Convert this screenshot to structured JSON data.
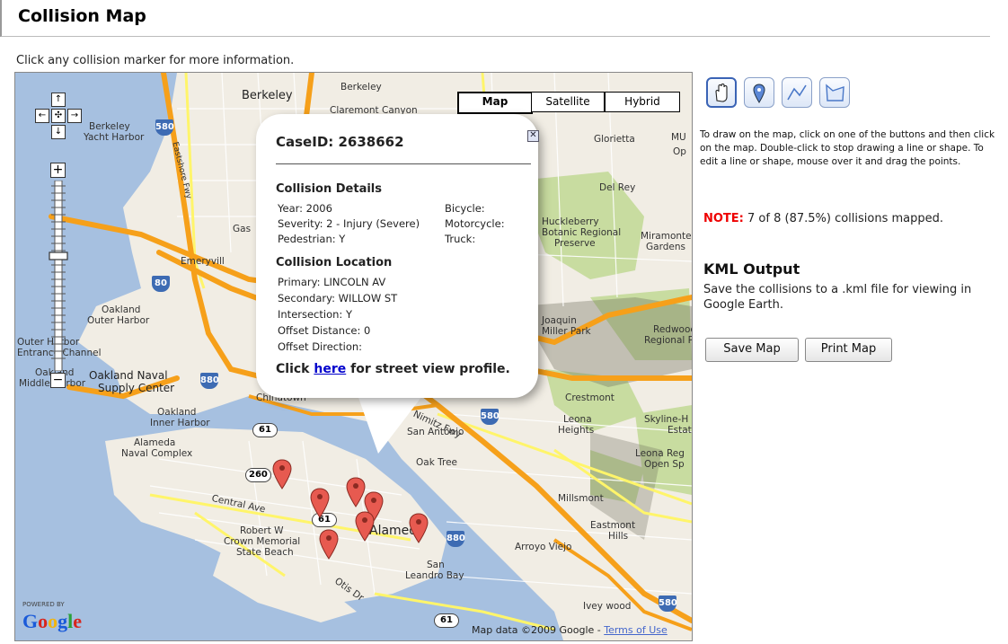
{
  "page": {
    "title": "Collision Map",
    "subtitle": "Click any collision marker for more information."
  },
  "map": {
    "type_buttons": [
      "Map",
      "Satellite",
      "Hybrid"
    ],
    "active_type": "Map",
    "pan_icons": [
      "arrow-up-icon",
      "arrow-left-icon",
      "pan-center-icon",
      "arrow-right-icon",
      "arrow-down-icon"
    ],
    "zoom_in": "+",
    "zoom_out": "−",
    "place_labels": [
      "Berkeley",
      "Berkeley",
      "Claremont Canyon",
      "Berkeley",
      "Yacht Harbor",
      "Eastshore Fwy",
      "Gas",
      "Emeryvill",
      "Oakland",
      "Outer Harbor",
      "Outer Harbor",
      "Entrance Channel",
      "Oakland",
      "Middle Harbor",
      "Oakland Naval",
      "Supply Center",
      "Chinatown",
      "Oakland",
      "Inner Harbor",
      "Alameda",
      "Naval Complex",
      "Central Ave",
      "Robert W",
      "Crown Memorial",
      "State Beach",
      "Alameda",
      "San",
      "Leandro Bay",
      "Otis Dr",
      "Glorietta",
      "Del Rey",
      "Huckleberry",
      "Botanic Regional",
      "Preserve",
      "Miramonte",
      "Gardens",
      "Joaquin",
      "Miller Park",
      "Redwood",
      "Regional Park",
      "Crestmont",
      "Leona",
      "Heights",
      "Skyline-H",
      "Estat",
      "Leona Reg",
      "Open Sp",
      "Oak Tree",
      "San Antonio",
      "Millsmont",
      "Eastmont",
      "Hills",
      "Arroyo Viejo",
      "Ivey wood",
      "Nimitz Fwy"
    ],
    "highway_shields": [
      "580",
      "80",
      "880",
      "61",
      "260",
      "61",
      "61",
      "880",
      "580",
      "580",
      "MU",
      "Op"
    ],
    "popup": {
      "case_id": "CaseID: 2638662",
      "close_icon": "close-x-icon",
      "details_heading": "Collision Details",
      "details_left": [
        "Year: 2006",
        "Severity: 2 - Injury (Severe)",
        "Pedestrian: Y"
      ],
      "details_right": [
        "Bicycle:",
        "Motorcycle:",
        "Truck:"
      ],
      "location_heading": "Collision Location",
      "location": [
        "Primary: LINCOLN AV",
        "Secondary: WILLOW ST",
        "Intersection: Y",
        "Offset Distance: 0",
        "Offset Direction:"
      ],
      "streetview_prefix": "Click ",
      "streetview_link": "here",
      "streetview_suffix": " for street view profile."
    },
    "marker_count": 8,
    "attribution": "Map data ©2009 Google - ",
    "terms_link": "Terms of Use",
    "powered_by": "POWERED BY",
    "logo": "Google"
  },
  "tools": {
    "icons": [
      "hand-pan-icon",
      "placemark-icon",
      "draw-line-icon",
      "draw-shape-icon"
    ],
    "active": "hand-pan-icon",
    "instructions": "To draw on the map, click on one of the buttons and then click on the map. Double-click to stop drawing a line or shape. To edit a line or shape, mouse over it and drag the points."
  },
  "note": {
    "label": "NOTE:",
    "text": " 7 of 8 (87.5%) collisions mapped."
  },
  "kml": {
    "title": "KML Output",
    "text": "Save the collisions to a .kml file for viewing in Google Earth."
  },
  "buttons": {
    "save": "Save Map",
    "print": "Print Map"
  },
  "colors": {
    "water": "#a6c0e0",
    "land": "#f1ede4",
    "park": "#c8dca0",
    "freeway": "#f6a01a",
    "arterial": "#fff56a",
    "marker": "#e75a50",
    "note_label": "#ee0000"
  }
}
